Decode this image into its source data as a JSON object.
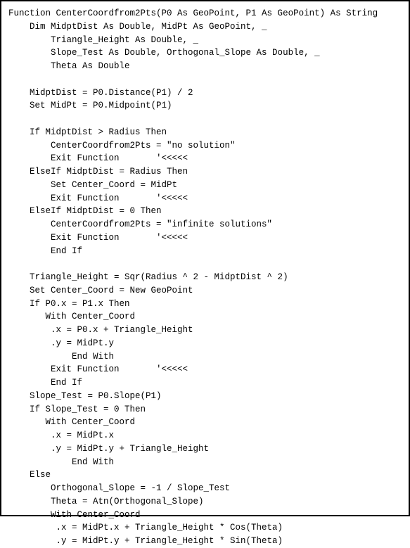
{
  "code": {
    "lines": [
      "Function CenterCoordfrom2Pts(P0 As GeoPoint, P1 As GeoPoint) As String",
      "    Dim MidptDist As Double, MidPt As GeoPoint, _",
      "        Triangle_Height As Double, _",
      "        Slope_Test As Double, Orthogonal_Slope As Double, _",
      "        Theta As Double",
      "",
      "    MidptDist = P0.Distance(P1) / 2",
      "    Set MidPt = P0.Midpoint(P1)",
      "",
      "    If MidptDist > Radius Then",
      "        CenterCoordfrom2Pts = \"no solution\"",
      "        Exit Function       '<<<<<",
      "    ElseIf MidptDist = Radius Then",
      "        Set Center_Coord = MidPt",
      "        Exit Function       '<<<<<",
      "    ElseIf MidptDist = 0 Then",
      "        CenterCoordfrom2Pts = \"infinite solutions\"",
      "        Exit Function       '<<<<<",
      "        End If",
      "",
      "    Triangle_Height = Sqr(Radius ^ 2 - MidptDist ^ 2)",
      "    Set Center_Coord = New GeoPoint",
      "    If P0.x = P1.x Then",
      "       With Center_Coord",
      "        .x = P0.x + Triangle_Height",
      "        .y = MidPt.y",
      "            End With",
      "        Exit Function       '<<<<<",
      "        End If",
      "    Slope_Test = P0.Slope(P1)",
      "    If Slope_Test = 0 Then",
      "       With Center_Coord",
      "        .x = MidPt.x",
      "        .y = MidPt.y + Triangle_Height",
      "            End With",
      "    Else",
      "        Orthogonal_Slope = -1 / Slope_Test",
      "        Theta = Atn(Orthogonal_Slope)",
      "        With Center_Coord",
      "         .x = MidPt.x + Triangle_Height * Cos(Theta)",
      "         .y = MidPt.y + Triangle_Height * Sin(Theta)"
    ]
  }
}
